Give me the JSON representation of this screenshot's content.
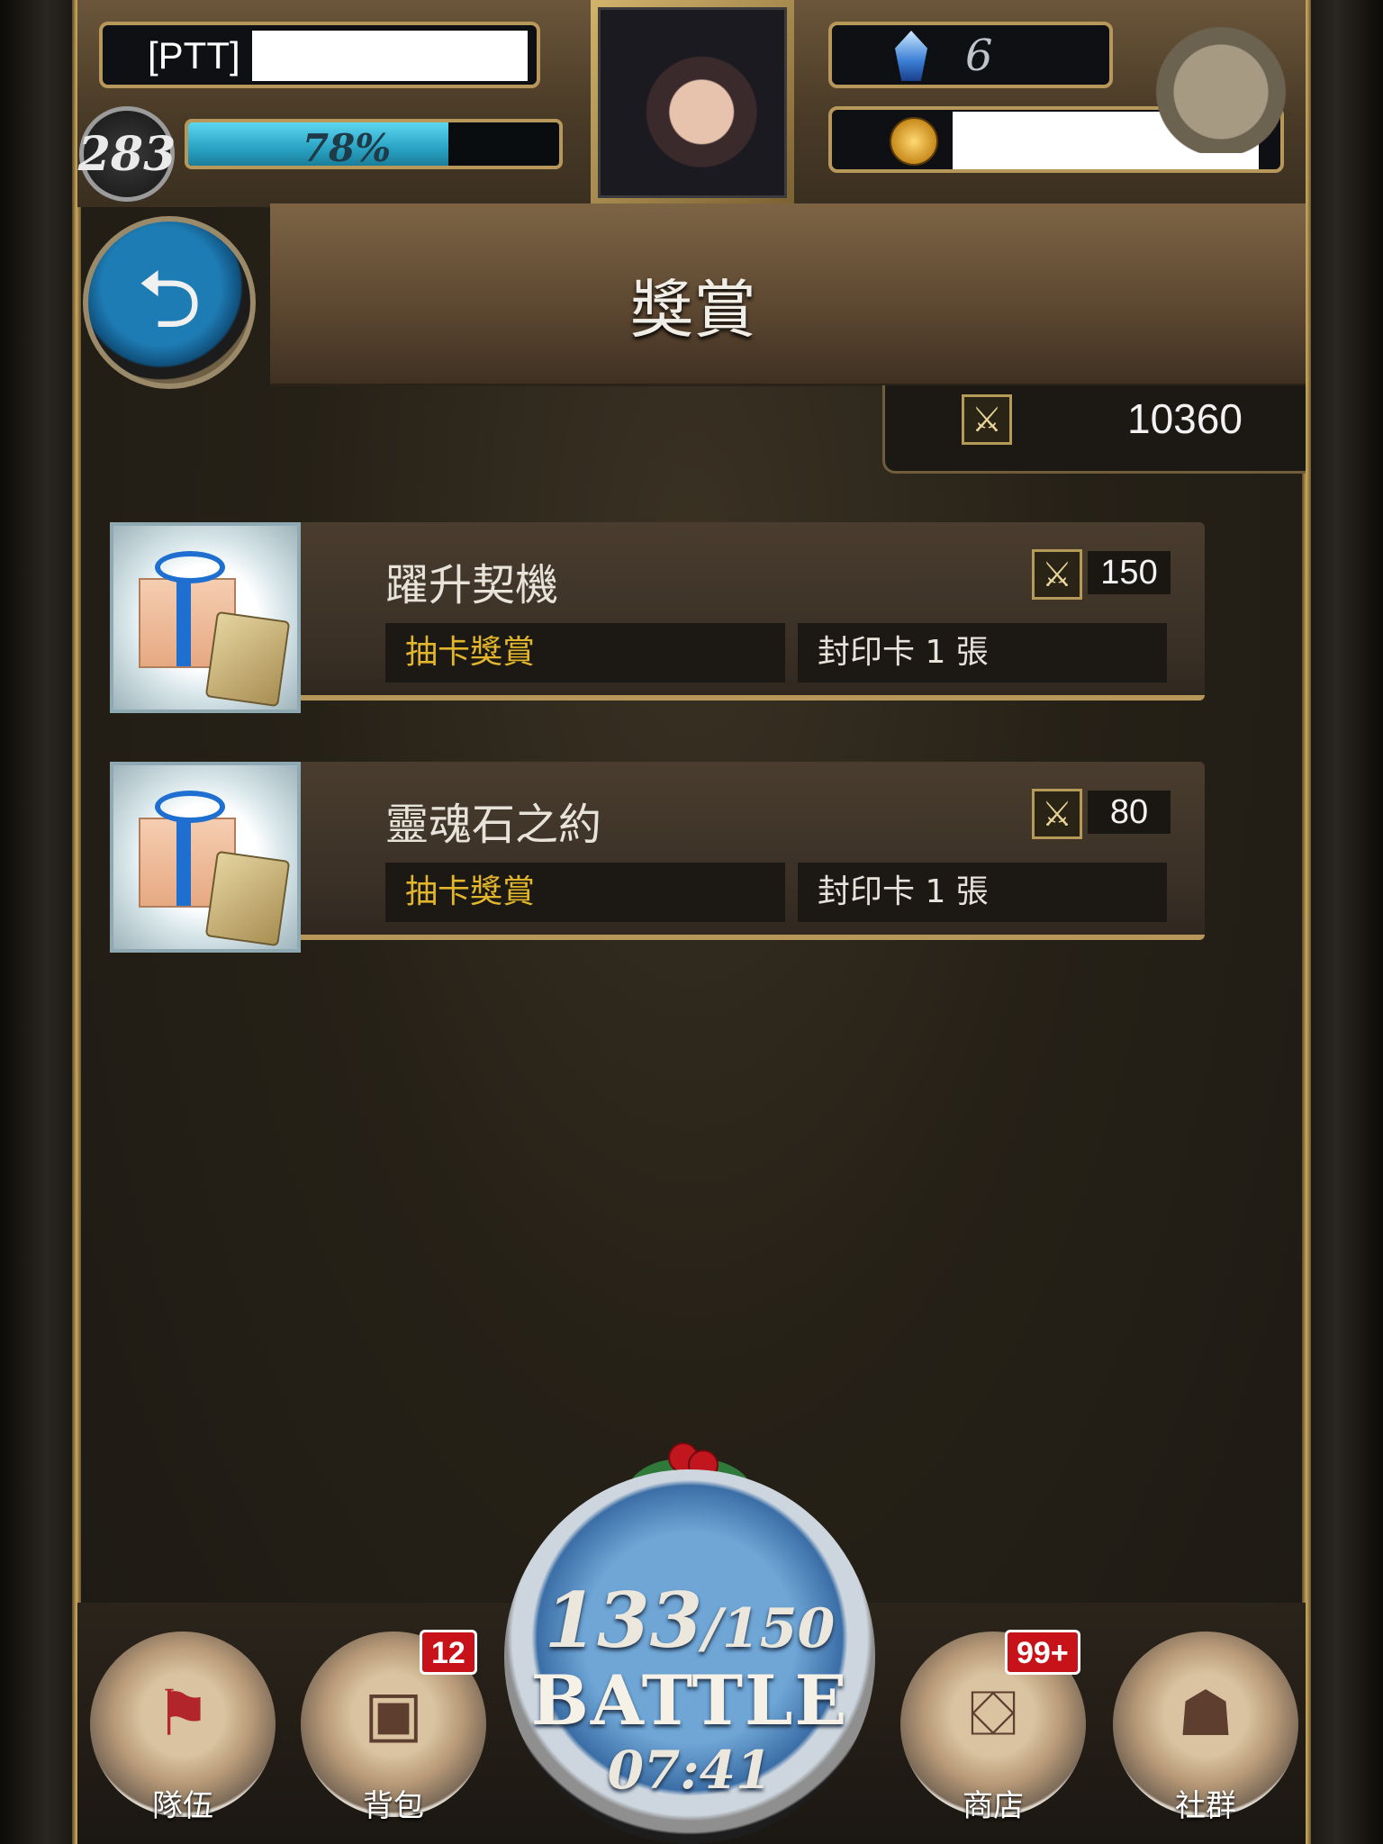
{
  "player": {
    "name_prefix": "[PTT]",
    "level": "283",
    "exp_text": "78%",
    "exp_fraction": 0.78
  },
  "currency": {
    "crystals": "6",
    "crystal_icon": "blue-crystal-icon",
    "coin_icon": "gold-coin-icon"
  },
  "header": {
    "title": "獎賞",
    "back_icon": "back-arrow-icon"
  },
  "points": {
    "icon": "crossed-swords-icon",
    "value": "10360"
  },
  "rewards": [
    {
      "title": "躍升契機",
      "cost": "150",
      "category": "抽卡獎賞",
      "detail": "封印卡 1 張",
      "thumb_icon": "gift-box-icon"
    },
    {
      "title": "靈魂石之約",
      "cost": "80",
      "category": "抽卡獎賞",
      "detail": "封印卡 1 張",
      "thumb_icon": "gift-box-icon"
    }
  ],
  "nav": {
    "team": {
      "label": "隊伍",
      "icon": "red-flag-icon"
    },
    "bag": {
      "label": "背包",
      "icon": "backpack-icon",
      "badge": "12"
    },
    "battle": {
      "ap_current": "133",
      "ap_max": "/150",
      "label": "BATTLE",
      "timer": "07:41"
    },
    "shop": {
      "label": "商店",
      "icon": "treasure-chest-icon",
      "badge": "99+"
    },
    "social": {
      "label": "社群",
      "icon": "people-icon"
    }
  },
  "colors": {
    "gold_trim": "#b8975a",
    "category_text": "#e2b62c",
    "badge_red": "#c8121a",
    "exp_bar": "#2aa3c4"
  }
}
